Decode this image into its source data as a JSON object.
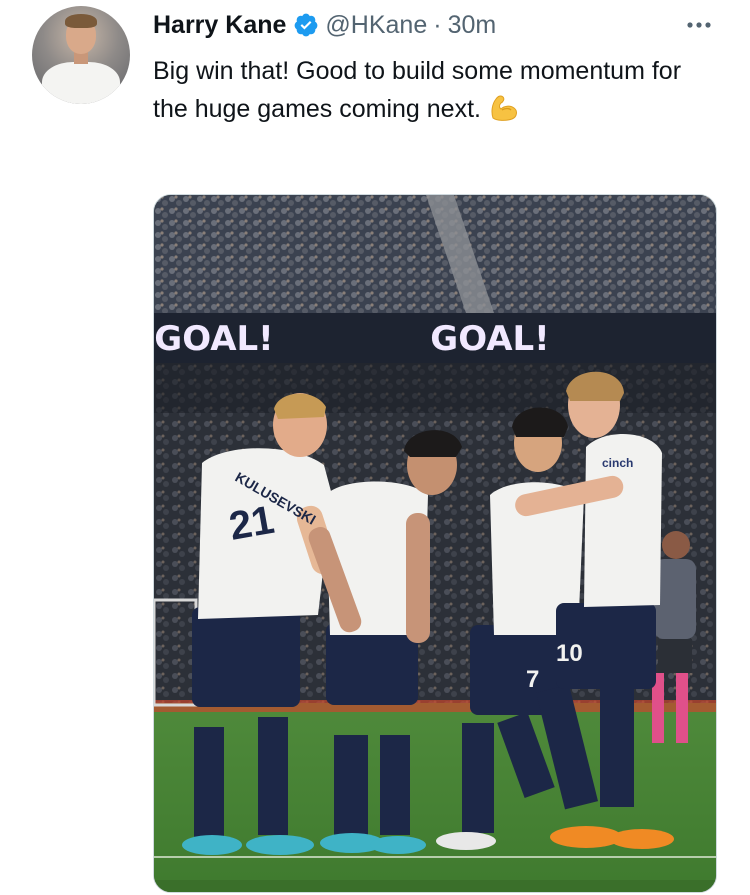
{
  "tweet": {
    "author_name": "Harry Kane",
    "author_handle": "@HKane",
    "separator": "·",
    "timestamp": "30m",
    "verified_icon": "verified-badge-icon",
    "more_icon": "more-options-icon",
    "text": "Big win that! Good to build some momentum for the huge games coming next.",
    "emoji": "flexed-biceps-emoji",
    "accent_color": "#1d9bf0"
  },
  "media": {
    "board_text_left": "GOAL!",
    "board_text_right": "GOAL!",
    "shirt_name": "KULUSEVSKI",
    "shirt_number_left": "21",
    "shirt_number_mid": "7",
    "shirt_number_right": "10",
    "sleeve_sponsor": "cinch",
    "shirt_back_number": "10"
  }
}
